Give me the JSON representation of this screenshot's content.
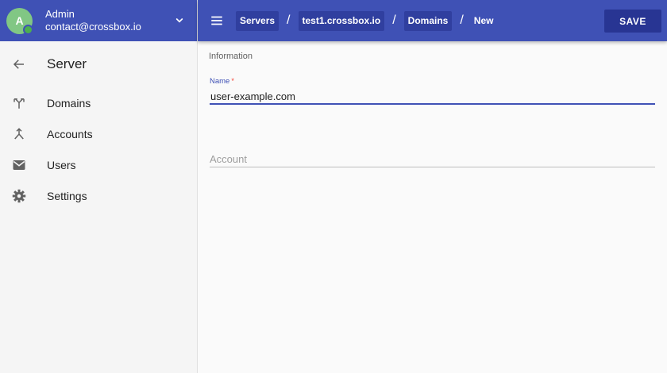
{
  "account": {
    "avatar_letter": "A",
    "name": "Admin",
    "email": "contact@crossbox.io",
    "status_color": "#4caf50"
  },
  "sidebar": {
    "title": "Server",
    "items": [
      {
        "label": "Domains",
        "icon": "fork-icon"
      },
      {
        "label": "Accounts",
        "icon": "merge-icon"
      },
      {
        "label": "Users",
        "icon": "mail-icon"
      },
      {
        "label": "Settings",
        "icon": "gear-icon"
      }
    ]
  },
  "breadcrumb": {
    "items": [
      "Servers",
      "test1.crossbox.io",
      "Domains"
    ],
    "separator": "/",
    "current": "New"
  },
  "toolbar": {
    "save_label": "SAVE"
  },
  "form": {
    "section_title": "Information",
    "name_label": "Name",
    "name_required_mark": "*",
    "name_value": "user-example.com",
    "account_placeholder": "Account"
  },
  "colors": {
    "primary": "#3f51b5",
    "primary_dark": "#303f9f",
    "save_button": "#283593"
  }
}
